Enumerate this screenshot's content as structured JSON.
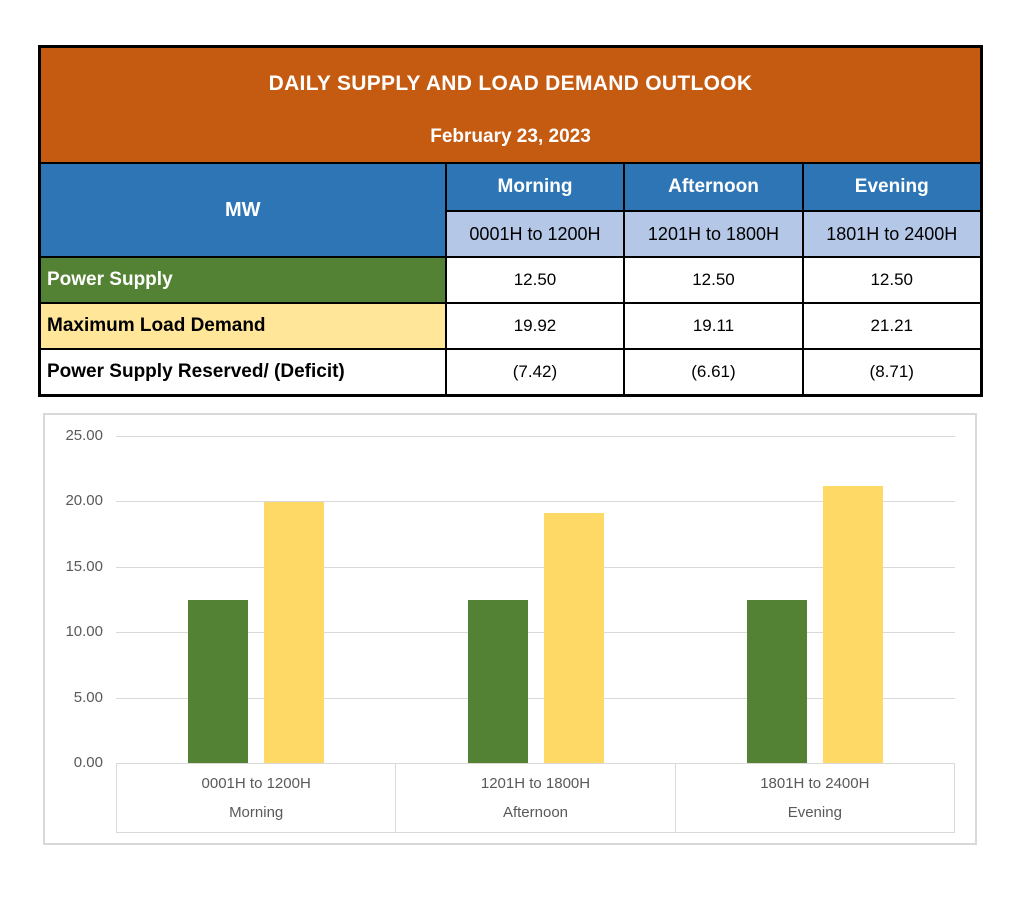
{
  "header": {
    "title": "DAILY SUPPLY AND LOAD DEMAND OUTLOOK",
    "date": "February 23, 2023"
  },
  "table": {
    "unit_label": "MW",
    "columns": [
      {
        "period": "Morning",
        "hours": "0001H to 1200H"
      },
      {
        "period": "Afternoon",
        "hours": "1201H to 1800H"
      },
      {
        "period": "Evening",
        "hours": "1801H to 2400H"
      }
    ],
    "rows": [
      {
        "label": "Power Supply",
        "values": [
          "12.50",
          "12.50",
          "12.50"
        ]
      },
      {
        "label": "Maximum Load Demand",
        "values": [
          "19.92",
          "19.11",
          "21.21"
        ]
      },
      {
        "label": "Power Supply Reserved/ (Deficit)",
        "values": [
          "(7.42)",
          "(6.61)",
          "(8.71)"
        ]
      }
    ]
  },
  "chart_data": {
    "type": "bar",
    "title": "",
    "xlabel": "",
    "ylabel": "",
    "categories": [
      {
        "hours": "0001H to 1200H",
        "period": "Morning"
      },
      {
        "hours": "1201H to 1800H",
        "period": "Afternoon"
      },
      {
        "hours": "1801H to 2400H",
        "period": "Evening"
      }
    ],
    "series": [
      {
        "name": "Power Supply",
        "color": "#548235",
        "values": [
          12.5,
          12.5,
          12.5
        ]
      },
      {
        "name": "Maximum Load Demand",
        "color": "#FFD966",
        "values": [
          19.92,
          19.11,
          21.21
        ]
      }
    ],
    "ylim": [
      0,
      25
    ],
    "ytick_step": 5,
    "ytick_labels": [
      "0.00",
      "5.00",
      "10.00",
      "15.00",
      "20.00",
      "25.00"
    ],
    "grid": true,
    "legend": "none"
  },
  "colors": {
    "title_bg": "#C55A11",
    "header_bg": "#2E75B6",
    "subheader_bg": "#B4C7E7",
    "supply_row_bg": "#548235",
    "demand_row_bg": "#FFE699",
    "chart_green": "#548235",
    "chart_yellow": "#FFD966",
    "chart_grid": "#D9D9D9",
    "chart_text": "#595959"
  }
}
